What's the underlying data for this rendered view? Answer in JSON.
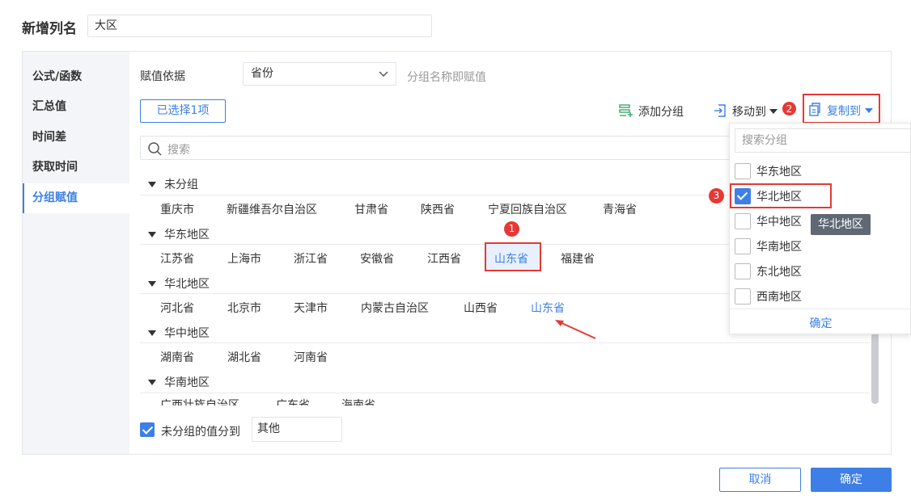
{
  "header": {
    "label": "新增列名",
    "value": "大区"
  },
  "sidebar": {
    "items": [
      {
        "label": "公式/函数"
      },
      {
        "label": "汇总值"
      },
      {
        "label": "时间差"
      },
      {
        "label": "获取时间"
      },
      {
        "label": "分组赋值",
        "active": true
      }
    ]
  },
  "assign": {
    "label": "赋值依据",
    "value": "省份",
    "hint": "分组名称即赋值"
  },
  "toolbar": {
    "selected_prefix": "已选择",
    "selected_count": "1",
    "selected_suffix": "项",
    "add_group": "添加分组",
    "move_to": "移动到",
    "copy_to": "复制到"
  },
  "search": {
    "placeholder": "搜索"
  },
  "groups": [
    {
      "name": "未分组",
      "items": [
        "重庆市",
        "新疆维吾尔自治区",
        "甘肃省",
        "陕西省",
        "宁夏回族自治区",
        "青海省"
      ]
    },
    {
      "name": "华东地区",
      "items": [
        "江苏省",
        "上海市",
        "浙江省",
        "安徽省",
        "江西省",
        "山东省",
        "福建省"
      ]
    },
    {
      "name": "华北地区",
      "items": [
        "河北省",
        "北京市",
        "天津市",
        "内蒙古自治区",
        "山西省",
        "山东省"
      ]
    },
    {
      "name": "华中地区",
      "items": [
        "湖南省",
        "湖北省",
        "河南省"
      ]
    },
    {
      "name": "华南地区",
      "items": [
        "广西壮族自治区",
        "广东省",
        "海南省"
      ]
    }
  ],
  "ungrouped": {
    "label": "未分组的值分到",
    "value": "其他"
  },
  "footer": {
    "cancel": "取消",
    "ok": "确定"
  },
  "dropdown": {
    "placeholder": "搜索分组",
    "options": [
      {
        "label": "华东地区",
        "checked": false
      },
      {
        "label": "华北地区",
        "checked": true
      },
      {
        "label": "华中地区",
        "checked": false
      },
      {
        "label": "华南地区",
        "checked": false
      },
      {
        "label": "东北地区",
        "checked": false
      },
      {
        "label": "西南地区",
        "checked": false
      }
    ],
    "confirm": "确定",
    "tooltip": "华北地区"
  },
  "badges": [
    "1",
    "2",
    "3"
  ],
  "colors": {
    "accent": "#3d7fe6",
    "annotation": "#e53935",
    "sidebar_bg": "#f3f5f8"
  }
}
